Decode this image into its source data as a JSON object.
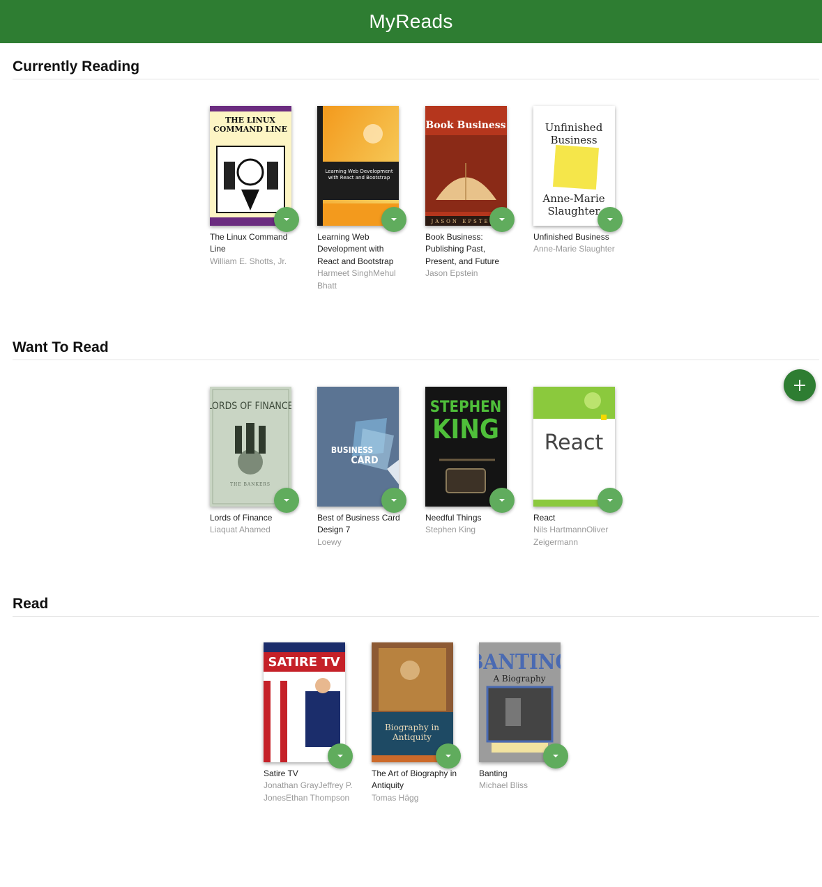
{
  "header": {
    "title": "MyReads"
  },
  "shelves": [
    {
      "title": "Currently Reading",
      "books": [
        {
          "title": "The Linux Command Line",
          "authors": "William E. Shotts, Jr.",
          "cover": {
            "label": "THE LINUX COMMAND LINE",
            "colors": [
              "#fdf5c4",
              "#6b2c80"
            ]
          }
        },
        {
          "title": "Learning Web Development with React and Bootstrap",
          "authors": "Harmeet SinghMehul Bhatt",
          "cover": {
            "label": "Learning Web Development with React and Bootstrap",
            "colors": [
              "#f39a1d",
              "#1d1d1d"
            ]
          }
        },
        {
          "title": "Book Business: Publishing Past, Present, and Future",
          "authors": "Jason Epstein",
          "cover": {
            "label": "Book Business",
            "colors": [
              "#b5361d",
              "#e8c28a"
            ]
          }
        },
        {
          "title": "Unfinished Business",
          "authors": "Anne-Marie Slaughter",
          "cover": {
            "label": "Unfinished Business",
            "sublabel": "Anne-Marie Slaughter",
            "colors": [
              "#ffffff",
              "#f5e64a"
            ]
          }
        }
      ]
    },
    {
      "title": "Want To Read",
      "books": [
        {
          "title": "Lords of Finance",
          "authors": "Liaquat Ahamed",
          "cover": {
            "label": "LORDS OF FINANCE",
            "colors": [
              "#c9d5c4",
              "#5d6b5a"
            ]
          }
        },
        {
          "title": "Best of Business Card Design 7",
          "authors": "Loewy",
          "cover": {
            "label": "BUSINESS CARD",
            "colors": [
              "#5b7493",
              "#dfe6ee"
            ]
          }
        },
        {
          "title": "Needful Things",
          "authors": "Stephen King",
          "cover": {
            "label": "STEPHEN KING",
            "colors": [
              "#141414",
              "#4fbf3a"
            ]
          }
        },
        {
          "title": "React",
          "authors": "Nils HartmannOliver Zeigermann",
          "cover": {
            "label": "React",
            "colors": [
              "#8bc93d",
              "#ffffff"
            ]
          }
        }
      ]
    },
    {
      "title": "Read",
      "books": [
        {
          "title": "Satire TV",
          "authors": "Jonathan GrayJeffrey P. JonesEthan Thompson",
          "cover": {
            "label": "SATIRE TV",
            "colors": [
              "#1b2d6b",
              "#c52128"
            ]
          }
        },
        {
          "title": "The Art of Biography in Antiquity",
          "authors": "Tomas Hägg",
          "cover": {
            "label": "Biography in Antiquity",
            "colors": [
              "#1e4a64",
              "#8d5a34"
            ]
          }
        },
        {
          "title": "Banting",
          "authors": "Michael Bliss",
          "cover": {
            "label": "BANTING",
            "sublabel": "A Biography",
            "colors": [
              "#9c9c9c",
              "#4a6ab2"
            ]
          }
        }
      ]
    }
  ],
  "search_button": {
    "icon": "plus-icon",
    "color": "#2e7d32"
  },
  "shelf_changer": {
    "icon": "chevron-down-icon",
    "color": "#60ac5d"
  }
}
